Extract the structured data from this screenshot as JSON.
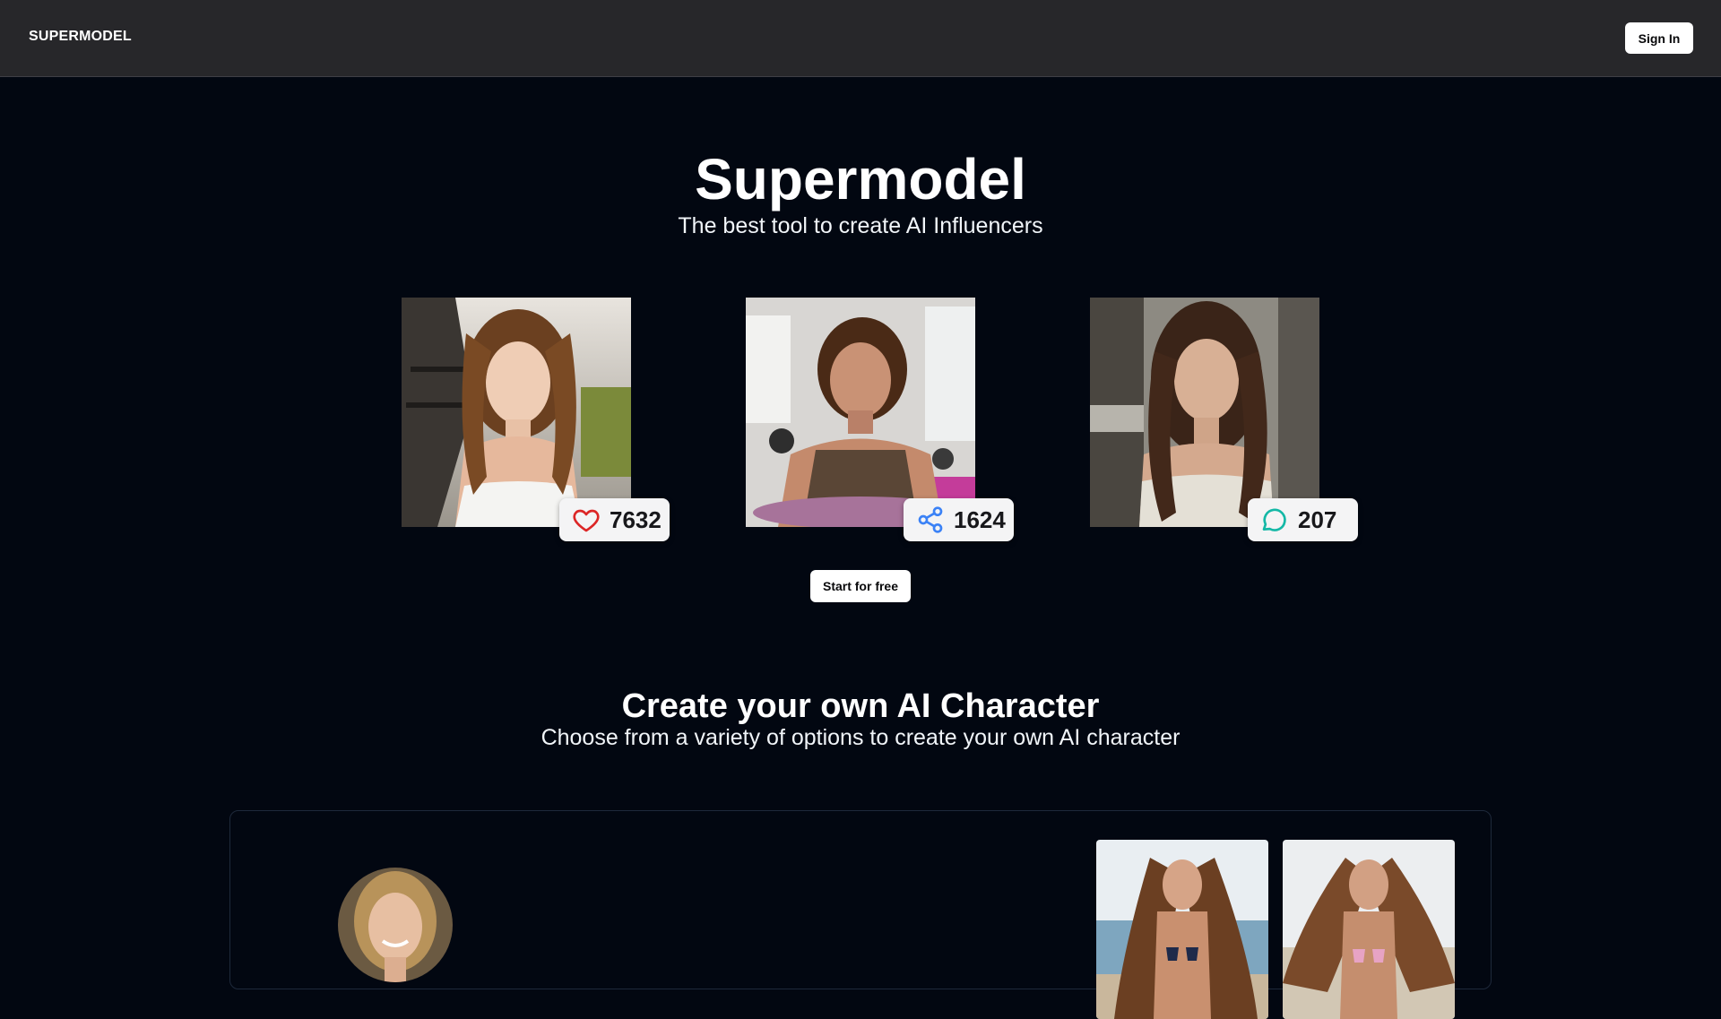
{
  "header": {
    "brand": "SUPERMODEL",
    "sign_in_label": "Sign In"
  },
  "hero": {
    "title": "Supermodel",
    "subtitle": "The best tool to create AI Influencers",
    "cta_label": "Start for free"
  },
  "showcase": [
    {
      "stat_icon": "heart-icon",
      "stat_value": "7632",
      "icon_color": "#dc2626"
    },
    {
      "stat_icon": "share-icon",
      "stat_value": "1624",
      "icon_color": "#3b82f6"
    },
    {
      "stat_icon": "chat-bubble-icon",
      "stat_value": "207",
      "icon_color": "#14b8a6"
    }
  ],
  "create_section": {
    "title": "Create your own AI Character",
    "subtitle": "Choose from a variety of options to create your own AI character"
  },
  "colors": {
    "page_background": "#020711",
    "header_background": "#27272a",
    "button_background": "#ffffff",
    "stat_badge_background": "#f4f4f5"
  }
}
